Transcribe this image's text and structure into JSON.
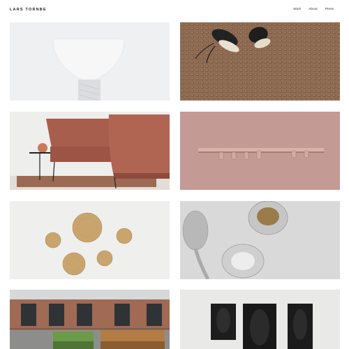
{
  "header": {
    "logo": "LARS TORNBE",
    "nav": [
      {
        "label": "Work"
      },
      {
        "label": "About"
      },
      {
        "label": "Press"
      }
    ]
  },
  "colors": {
    "background": "#ffffff",
    "rose": "#c49a94",
    "cork": "#8d6a52",
    "wood": "#c9a46c"
  },
  "projects": [
    {
      "icon": "white-lamp-image"
    },
    {
      "icon": "cork-mat-with-sneakers-image"
    },
    {
      "icon": "rust-sofa-with-side-table-image"
    },
    {
      "icon": "copper-coat-rack-image"
    },
    {
      "icon": "wooden-wall-dots-image"
    },
    {
      "icon": "silver-spoon-and-bowls-image"
    },
    {
      "icon": "outdoor-benches-brick-building-image"
    },
    {
      "icon": "black-sculptural-tiles-image"
    }
  ]
}
